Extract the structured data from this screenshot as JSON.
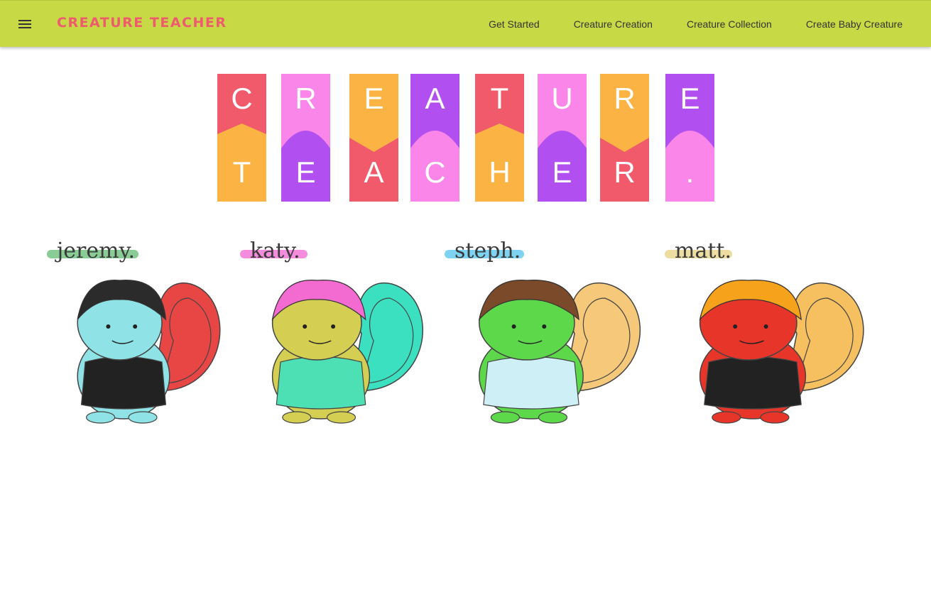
{
  "brand": "CREATURE TEACHER",
  "nav": {
    "items": [
      "Get Started",
      "Creature Creation",
      "Creature Collection",
      "Create Baby Creature"
    ]
  },
  "banner": {
    "tiles": [
      {
        "top": "C",
        "bottom": "T",
        "top_color": "#f05a6b",
        "bottom_color": "#fbb343"
      },
      {
        "top": "R",
        "bottom": "E",
        "top_color": "#f986e8",
        "bottom_color": "#b14ff0"
      },
      {
        "top": "E",
        "bottom": "A",
        "top_color": "#fbb343",
        "bottom_color": "#f05a6b"
      },
      {
        "top": "A",
        "bottom": "C",
        "top_color": "#b14ff0",
        "bottom_color": "#f986e8"
      },
      {
        "top": "T",
        "bottom": "H",
        "top_color": "#f05a6b",
        "bottom_color": "#fbb343"
      },
      {
        "top": "U",
        "bottom": "E",
        "top_color": "#f986e8",
        "bottom_color": "#b14ff0"
      },
      {
        "top": "R",
        "bottom": "R",
        "top_color": "#fbb343",
        "bottom_color": "#f05a6b"
      },
      {
        "top": "E",
        "bottom": ".",
        "top_color": "#b14ff0",
        "bottom_color": "#f986e8"
      }
    ]
  },
  "creatures": [
    {
      "name": "jeremy.",
      "stroke_color": "#6bbf7a",
      "body_color": "#8fe3e6",
      "hair_color": "#2b2b2b",
      "accent_color": "#e84545"
    },
    {
      "name": "katy.",
      "stroke_color": "#f06fd4",
      "body_color": "#d4cf52",
      "hair_color": "#f36bd1",
      "accent_color": "#3be0c0"
    },
    {
      "name": "steph.",
      "stroke_color": "#5ec8f0",
      "body_color": "#5ed84b",
      "hair_color": "#7a4a2a",
      "accent_color": "#f6c87a"
    },
    {
      "name": "matt.",
      "stroke_color": "#e8d58a",
      "body_color": "#e8352a",
      "hair_color": "#f6a21b",
      "accent_color": "#f6c060"
    }
  ]
}
